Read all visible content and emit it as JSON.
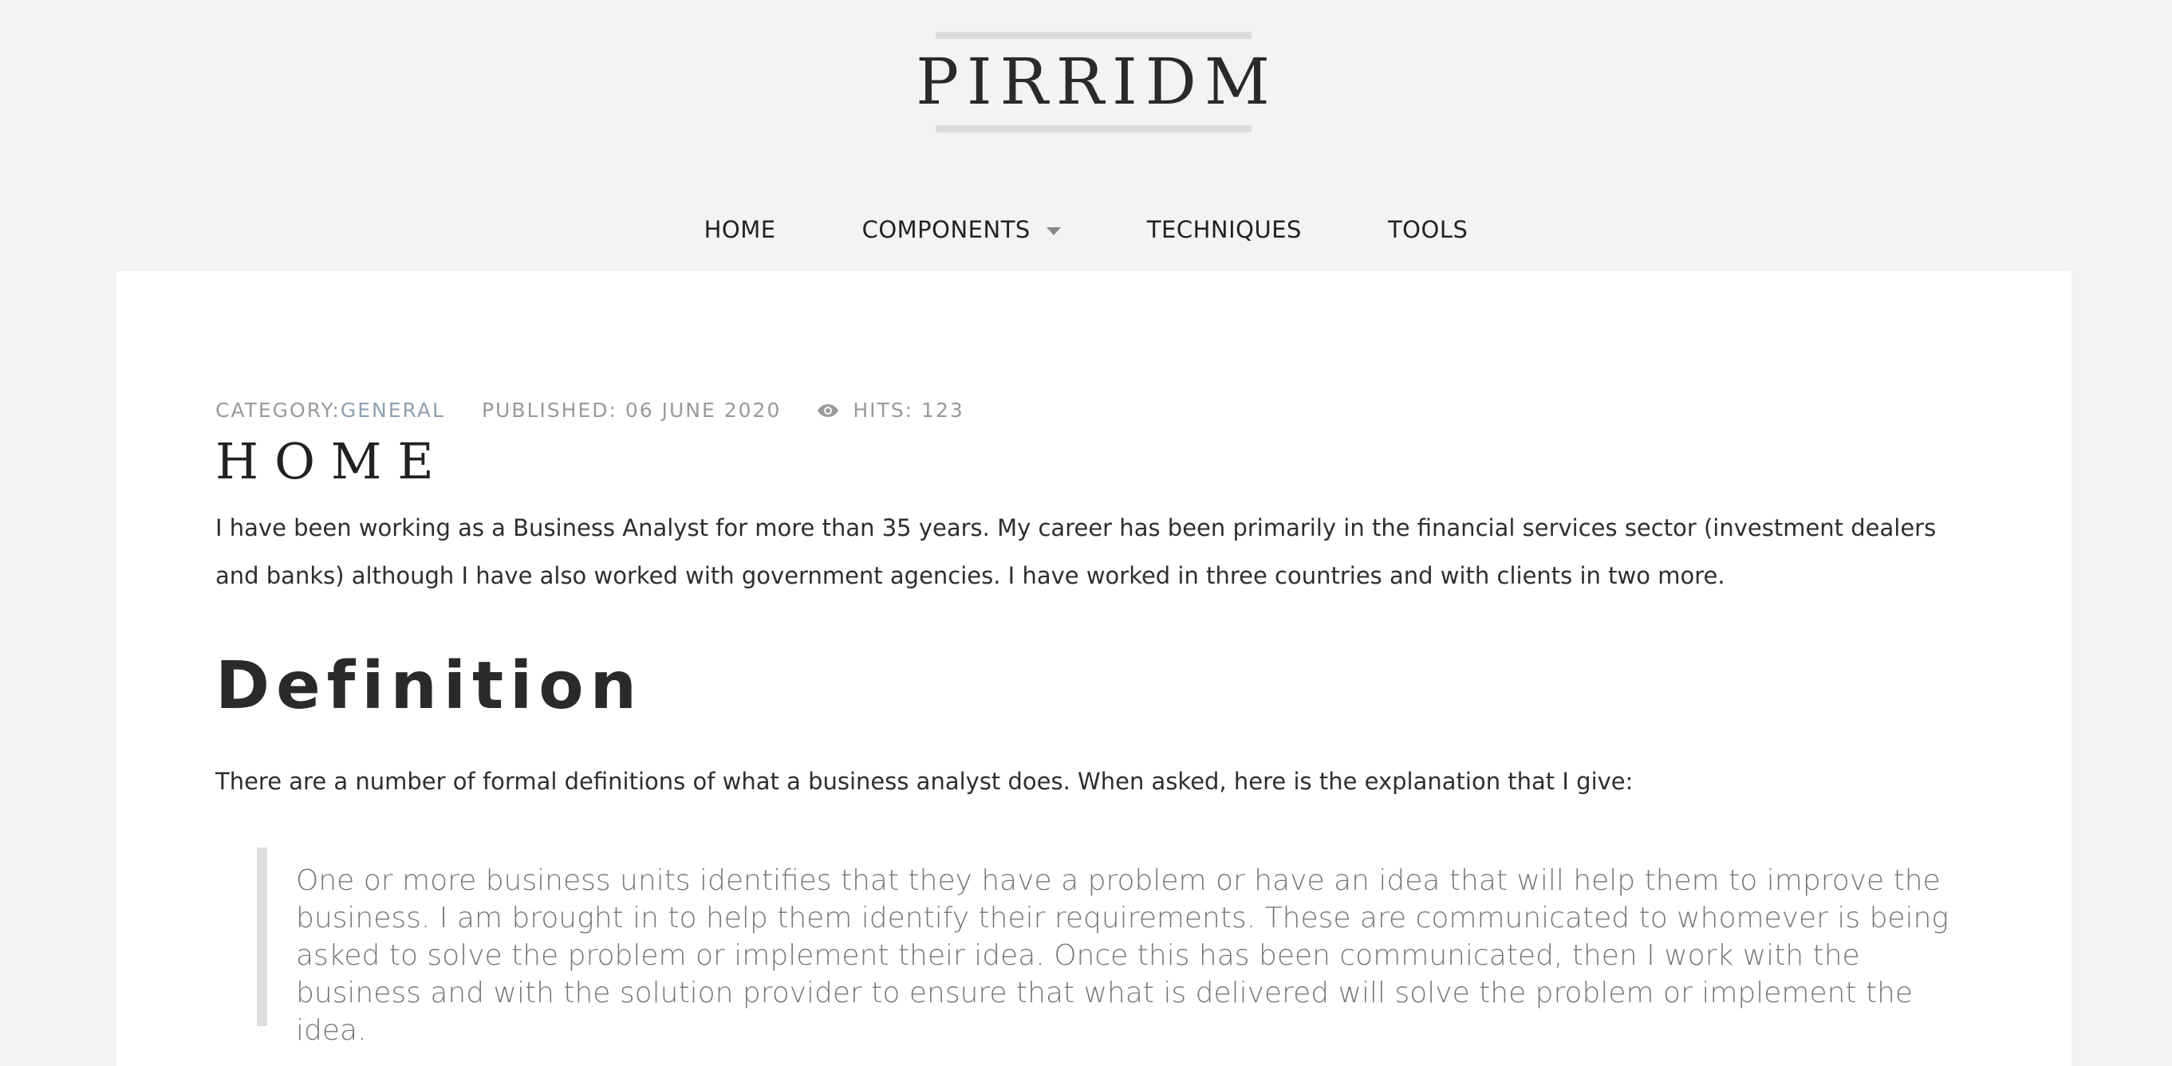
{
  "site": {
    "logo": "PIRRIDM"
  },
  "nav": {
    "items": [
      {
        "label": "HOME"
      },
      {
        "label": "COMPONENTS",
        "has_dropdown": true
      },
      {
        "label": "TECHNIQUES"
      },
      {
        "label": "TOOLS"
      }
    ]
  },
  "article": {
    "meta": {
      "category_label": "CATEGORY: ",
      "category_value": "GENERAL",
      "published": "PUBLISHED: 06 JUNE 2020",
      "hits": "HITS: 123",
      "hits_icon": "eye-icon"
    },
    "title": "HOME",
    "intro": "I have been working as a Business Analyst for more than 35 years. My career has been primarily in the financial services sector (investment dealers and banks) although I have also worked with government agencies. I have worked in three countries and with clients in two more.",
    "section_heading": "Definition",
    "definition_text": "There are a number of formal definitions of what a business analyst does. When asked, here is the explanation that I give:",
    "quote": "One or more business units identifies that they have a problem or have an idea that will help them to improve the business. I am brought in to help them identify their requirements. These are communicated to whomever is being asked to solve the problem or implement their idea. Once this has been communicated, then I work with the business and with the solution provider to ensure that what is delivered will solve the problem or implement the idea."
  },
  "colors": {
    "background": "#f3f3f3",
    "card": "#ffffff",
    "category_link": "#8fa0b4",
    "meta_text": "#9a9a9a",
    "quote_text": "#777777",
    "quote_border": "#dddddd"
  }
}
